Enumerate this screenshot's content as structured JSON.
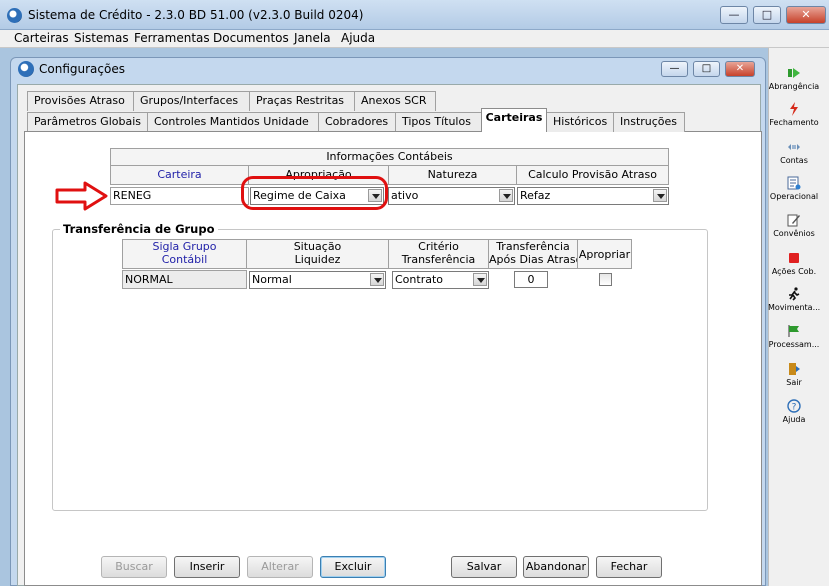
{
  "window": {
    "title": "Sistema de Crédito - 2.3.0 BD 51.00 (v2.3.0 Build 0204)",
    "minimize": "—",
    "maximize": "□",
    "close": "✕"
  },
  "menu": [
    "Carteiras",
    "Sistemas",
    "Ferramentas",
    "Documentos",
    "Janela",
    "Ajuda"
  ],
  "child": {
    "title": "Configurações",
    "minimize": "—",
    "maximize": "□",
    "close": "✕"
  },
  "tabs_row1": [
    "Provisões Atraso",
    "Grupos/Interfaces",
    "Praças Restritas",
    "Anexos SCR"
  ],
  "tabs_row2": [
    "Parâmetros Globais",
    "Controles Mantidos Unidade",
    "Cobradores",
    "Tipos Títulos",
    "Carteiras",
    "Históricos",
    "Instruções"
  ],
  "active_tab": "Carteiras",
  "info": {
    "group_header": "Informações Contábeis",
    "columns": [
      "Carteira",
      "Apropriação",
      "Natureza",
      "Calculo Provisão Atraso"
    ],
    "row": {
      "carteira": "RENEG",
      "apropriacao": "Regime de Caixa",
      "natureza": "ativo",
      "calculo": "Refaz"
    }
  },
  "transfer": {
    "title": "Transferência de Grupo",
    "columns": [
      {
        "l1": "Sigla Grupo",
        "l2": "Contábil"
      },
      {
        "l1": "Situação",
        "l2": "Liquidez"
      },
      {
        "l1": "Critério",
        "l2": "Transferência"
      },
      {
        "l1": "Transferência",
        "l2": "Após Dias Atraso"
      },
      {
        "l1": "Apropriar",
        "l2": ""
      }
    ],
    "row": {
      "sigla": "NORMAL",
      "situacao": "Normal",
      "criterio": "Contrato",
      "dias": "0",
      "apropriar": false
    }
  },
  "buttons": [
    "Buscar",
    "Inserir",
    "Alterar",
    "Excluir",
    "Salvar",
    "Abandonar",
    "Fechar"
  ],
  "sidebar": [
    "Abrangência",
    "Fechamento",
    "Contas",
    "Operacional",
    "Convênios",
    "Ações Cob.",
    "Movimenta...",
    "Processam...",
    "Sair",
    "Ajuda"
  ],
  "colors": {
    "annotation": "#e01010",
    "header_blue": "#1f1fa8",
    "title_bg": "#b3cbe6"
  }
}
